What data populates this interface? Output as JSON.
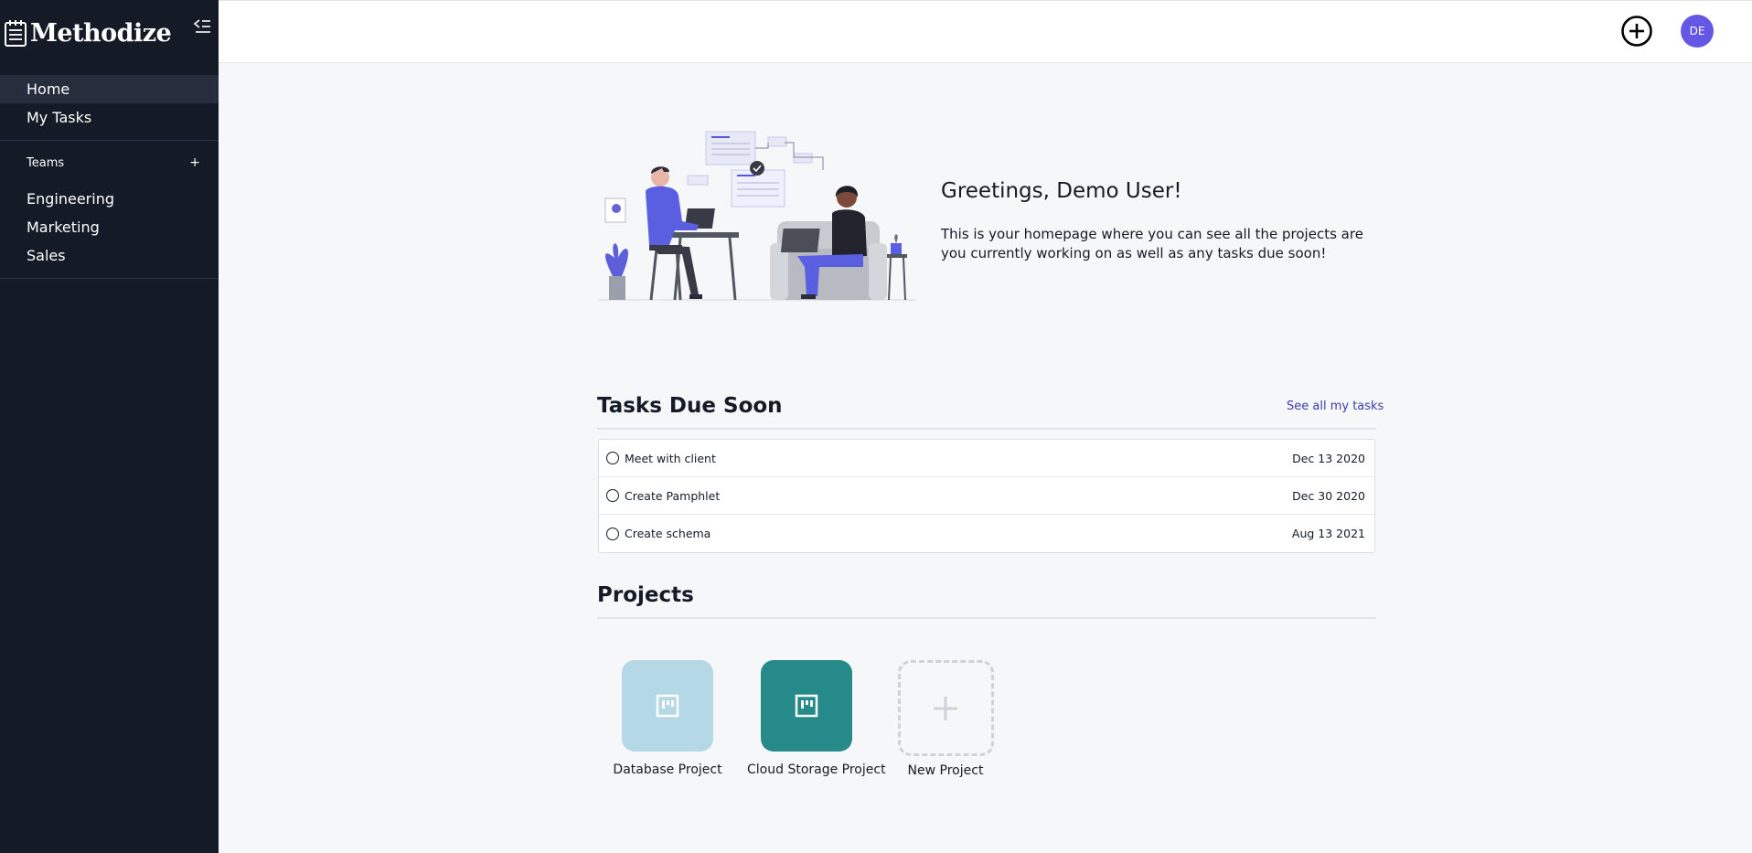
{
  "sidebar": {
    "brand": "Methodize",
    "nav": [
      {
        "label": "Home"
      },
      {
        "label": "My Tasks"
      }
    ],
    "teams_label": "Teams",
    "teams_add": "+",
    "teams": [
      {
        "label": "Engineering"
      },
      {
        "label": "Marketing"
      },
      {
        "label": "Sales"
      }
    ]
  },
  "topbar": {
    "avatar_initials": "DE",
    "add_icon": "plus-circle-icon"
  },
  "greeting": {
    "title": "Greetings, Demo User!",
    "text": "This is your homepage where you can see all the projects are you currently working on as well as any tasks due soon!"
  },
  "tasks": {
    "title": "Tasks Due Soon",
    "see_all": "See all my tasks",
    "items": [
      {
        "name": "Meet with client",
        "due": "Dec 13 2020"
      },
      {
        "name": "Create Pamphlet",
        "due": "Dec 30 2020"
      },
      {
        "name": "Create schema",
        "due": "Aug 13 2021"
      }
    ]
  },
  "projects": {
    "title": "Projects",
    "items": [
      {
        "name": "Database Project",
        "color": "#b5d8e6",
        "icon": "board-icon"
      },
      {
        "name": "Cloud Storage Project",
        "color": "#268a8a",
        "icon": "board-icon"
      }
    ],
    "new_label": "New Project"
  },
  "colors": {
    "sidebar_bg": "#151b26",
    "accent": "#6457e6",
    "link": "#3b3bb0"
  }
}
